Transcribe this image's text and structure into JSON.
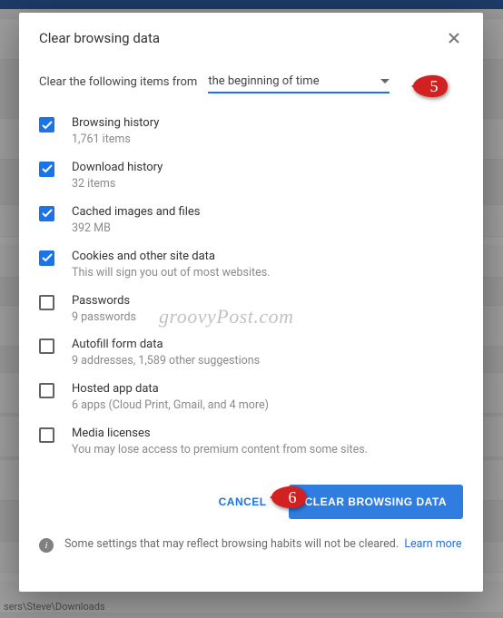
{
  "dialog": {
    "title": "Clear browsing data",
    "from_label": "Clear the following items from",
    "from_value": "the beginning of time",
    "cancel_label": "CANCEL",
    "clear_label": "CLEAR BROWSING DATA",
    "footer_text": "Some settings that may reflect browsing habits will not be cleared.",
    "learn_more": "Learn more"
  },
  "items": [
    {
      "checked": true,
      "title": "Browsing history",
      "sub": "1,761 items"
    },
    {
      "checked": true,
      "title": "Download history",
      "sub": "32 items"
    },
    {
      "checked": true,
      "title": "Cached images and files",
      "sub": "392 MB"
    },
    {
      "checked": true,
      "title": "Cookies and other site data",
      "sub": "This will sign you out of most websites."
    },
    {
      "checked": false,
      "title": "Passwords",
      "sub": "9 passwords"
    },
    {
      "checked": false,
      "title": "Autofill form data",
      "sub": "9 addresses, 1,589 other suggestions"
    },
    {
      "checked": false,
      "title": "Hosted app data",
      "sub": "6 apps (Cloud Print, Gmail, and 4 more)"
    },
    {
      "checked": false,
      "title": "Media licenses",
      "sub": "You may lose access to premium content from some sites."
    }
  ],
  "watermark": "groovyPost.com",
  "callouts": {
    "five": "5",
    "six": "6"
  },
  "bg_path": "sers\\Steve\\Downloads"
}
